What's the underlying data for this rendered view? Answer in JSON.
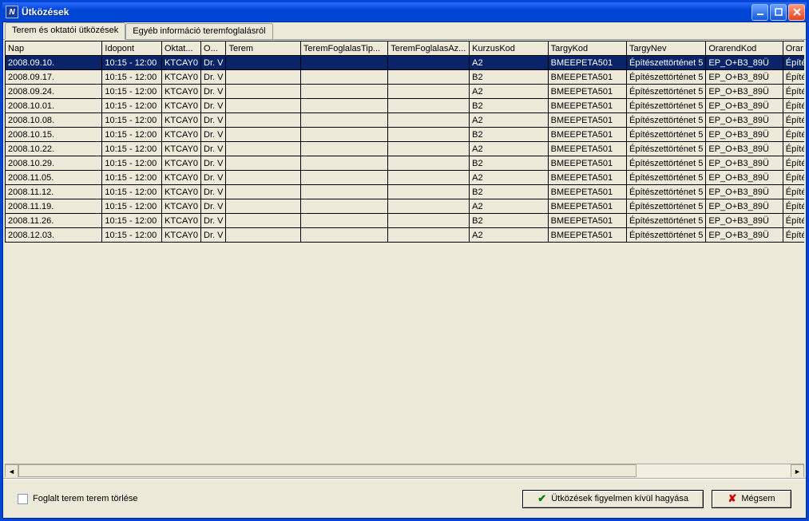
{
  "window": {
    "title": "Ütközések"
  },
  "tabs": {
    "active": "Terem és oktatói ütközések",
    "other": "Egyéb információ teremfoglalásról"
  },
  "grid": {
    "columns": {
      "nap": "Nap",
      "ido": "Idopont",
      "okt": "Oktat...",
      "o": "O...",
      "terem": "Terem",
      "tft": "TeremFoglalasTip...",
      "tfa": "TeremFoglalasAz...",
      "kurz": "KurzusKod",
      "targ": "TargyKod",
      "tnev": "TargyNev",
      "ora": "OrarendKod",
      "orar": "Orar"
    },
    "rows": [
      {
        "nap": "2008.09.10.",
        "ido": "10:15 - 12:00",
        "okt": "KTCAY0",
        "o": "Dr. V",
        "terem": "",
        "tft": "",
        "tfa": "",
        "kurz": "A2",
        "targ": "BMEEPETA501",
        "tnev": "Építészettörténet 5",
        "ora": "EP_O+B3_89Ü",
        "orar": "Építé",
        "selected": true
      },
      {
        "nap": "2008.09.17.",
        "ido": "10:15 - 12:00",
        "okt": "KTCAY0",
        "o": "Dr. V",
        "terem": "",
        "tft": "",
        "tfa": "",
        "kurz": "B2",
        "targ": "BMEEPETA501",
        "tnev": "Építészettörténet 5",
        "ora": "EP_O+B3_89Ü",
        "orar": "Építé"
      },
      {
        "nap": "2008.09.24.",
        "ido": "10:15 - 12:00",
        "okt": "KTCAY0",
        "o": "Dr. V",
        "terem": "",
        "tft": "",
        "tfa": "",
        "kurz": "A2",
        "targ": "BMEEPETA501",
        "tnev": "Építészettörténet 5",
        "ora": "EP_O+B3_89Ü",
        "orar": "Építé"
      },
      {
        "nap": "2008.10.01.",
        "ido": "10:15 - 12:00",
        "okt": "KTCAY0",
        "o": "Dr. V",
        "terem": "",
        "tft": "",
        "tfa": "",
        "kurz": "B2",
        "targ": "BMEEPETA501",
        "tnev": "Építészettörténet 5",
        "ora": "EP_O+B3_89Ü",
        "orar": "Építé"
      },
      {
        "nap": "2008.10.08.",
        "ido": "10:15 - 12:00",
        "okt": "KTCAY0",
        "o": "Dr. V",
        "terem": "",
        "tft": "",
        "tfa": "",
        "kurz": "A2",
        "targ": "BMEEPETA501",
        "tnev": "Építészettörténet 5",
        "ora": "EP_O+B3_89Ü",
        "orar": "Építé"
      },
      {
        "nap": "2008.10.15.",
        "ido": "10:15 - 12:00",
        "okt": "KTCAY0",
        "o": "Dr. V",
        "terem": "",
        "tft": "",
        "tfa": "",
        "kurz": "B2",
        "targ": "BMEEPETA501",
        "tnev": "Építészettörténet 5",
        "ora": "EP_O+B3_89Ü",
        "orar": "Építé"
      },
      {
        "nap": "2008.10.22.",
        "ido": "10:15 - 12:00",
        "okt": "KTCAY0",
        "o": "Dr. V",
        "terem": "",
        "tft": "",
        "tfa": "",
        "kurz": "A2",
        "targ": "BMEEPETA501",
        "tnev": "Építészettörténet 5",
        "ora": "EP_O+B3_89Ü",
        "orar": "Építé"
      },
      {
        "nap": "2008.10.29.",
        "ido": "10:15 - 12:00",
        "okt": "KTCAY0",
        "o": "Dr. V",
        "terem": "",
        "tft": "",
        "tfa": "",
        "kurz": "B2",
        "targ": "BMEEPETA501",
        "tnev": "Építészettörténet 5",
        "ora": "EP_O+B3_89Ü",
        "orar": "Építé"
      },
      {
        "nap": "2008.11.05.",
        "ido": "10:15 - 12:00",
        "okt": "KTCAY0",
        "o": "Dr. V",
        "terem": "",
        "tft": "",
        "tfa": "",
        "kurz": "A2",
        "targ": "BMEEPETA501",
        "tnev": "Építészettörténet 5",
        "ora": "EP_O+B3_89Ü",
        "orar": "Építé"
      },
      {
        "nap": "2008.11.12.",
        "ido": "10:15 - 12:00",
        "okt": "KTCAY0",
        "o": "Dr. V",
        "terem": "",
        "tft": "",
        "tfa": "",
        "kurz": "B2",
        "targ": "BMEEPETA501",
        "tnev": "Építészettörténet 5",
        "ora": "EP_O+B3_89Ü",
        "orar": "Építé"
      },
      {
        "nap": "2008.11.19.",
        "ido": "10:15 - 12:00",
        "okt": "KTCAY0",
        "o": "Dr. V",
        "terem": "",
        "tft": "",
        "tfa": "",
        "kurz": "A2",
        "targ": "BMEEPETA501",
        "tnev": "Építészettörténet 5",
        "ora": "EP_O+B3_89Ü",
        "orar": "Építé"
      },
      {
        "nap": "2008.11.26.",
        "ido": "10:15 - 12:00",
        "okt": "KTCAY0",
        "o": "Dr. V",
        "terem": "",
        "tft": "",
        "tfa": "",
        "kurz": "B2",
        "targ": "BMEEPETA501",
        "tnev": "Építészettörténet 5",
        "ora": "EP_O+B3_89Ü",
        "orar": "Építé"
      },
      {
        "nap": "2008.12.03.",
        "ido": "10:15 - 12:00",
        "okt": "KTCAY0",
        "o": "Dr. V",
        "terem": "",
        "tft": "",
        "tfa": "",
        "kurz": "A2",
        "targ": "BMEEPETA501",
        "tnev": "Építészettörténet 5",
        "ora": "EP_O+B3_89Ü",
        "orar": "Építé"
      }
    ]
  },
  "bottom": {
    "checkbox_label": "Foglalt terem terem törlése",
    "ignore_button": "Ütközések figyelmen kívül hagyása",
    "cancel_button": "Mégsem"
  }
}
